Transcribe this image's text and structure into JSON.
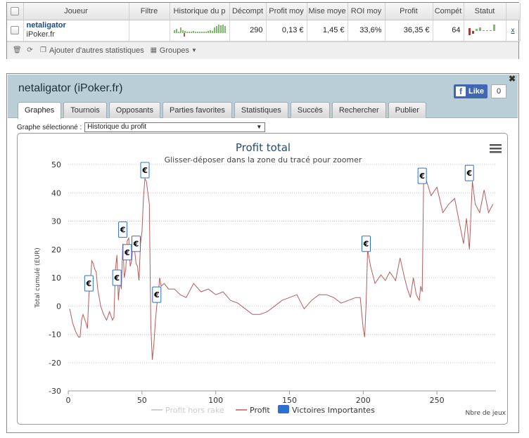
{
  "stats_table": {
    "columns": [
      "Joueur",
      "Filtre",
      "Historique du p",
      "Décompt",
      "Profit moy",
      "Mise moye",
      "ROI moy",
      "Profit",
      "Compét",
      "Statut"
    ],
    "row": {
      "player_name": "netaligator",
      "site": "iPoker.fr",
      "decompte": "290",
      "profit_moy": "0,13 €",
      "mise_moy": "1,45 €",
      "roi_moy": "33,6%",
      "profit": "36,35 €",
      "competitions": "64",
      "close": "x"
    }
  },
  "toolbar": {
    "add_stats": "Ajouter d'autres statistiques",
    "groups": "Groupes"
  },
  "panel": {
    "title": "netaligator (iPoker.fr)",
    "fb_like": "Like",
    "fb_count": "0",
    "tabs": [
      "Graphes",
      "Tournois",
      "Opposants",
      "Parties favorites",
      "Statistiques",
      "Succès",
      "Rechercher",
      "Publier"
    ],
    "graph_select_label": "Graphe sélectionné :",
    "graph_select_value": "Historique du profit"
  },
  "colors": {
    "profit_line": "#b85a5a",
    "rake_line": "#cfcfcf",
    "victory_marker": "#2c6fcf",
    "header_bg": "#b9ced6"
  },
  "chart_data": {
    "type": "line",
    "title": "Profit total",
    "subtitle": "Glisser-déposer dans la zone du tracé pour zoomer",
    "ylabel": "Total cumulé (EUR)",
    "xlabel": "Nbre de jeux",
    "xlim": [
      0,
      290
    ],
    "ylim": [
      -30,
      50
    ],
    "xticks": [
      0,
      50,
      100,
      150,
      200,
      250
    ],
    "yticks": [
      -30,
      -20,
      -10,
      0,
      10,
      20,
      30,
      40,
      50
    ],
    "legend": [
      "Profit hors rake",
      "Profit",
      "Victoires Importantes"
    ],
    "series": [
      {
        "name": "Profit",
        "x": [
          1,
          3,
          5,
          7,
          8,
          9,
          10,
          12,
          13,
          14,
          15,
          16,
          17,
          18,
          19,
          20,
          22,
          24,
          26,
          28,
          30,
          31,
          32,
          33,
          34,
          35,
          36,
          37,
          38,
          39,
          40,
          41,
          42,
          43,
          44,
          45,
          46,
          47,
          48,
          49,
          50,
          51,
          52,
          53,
          54,
          55,
          56,
          57,
          58,
          59,
          60,
          61,
          62,
          63,
          65,
          68,
          72,
          76,
          80,
          85,
          90,
          95,
          100,
          105,
          110,
          115,
          120,
          125,
          130,
          135,
          140,
          145,
          150,
          155,
          160,
          165,
          170,
          175,
          180,
          185,
          190,
          195,
          198,
          200,
          201,
          202,
          203,
          205,
          208,
          212,
          215,
          218,
          222,
          225,
          228,
          230,
          232,
          234,
          236,
          238,
          239,
          240,
          241,
          243,
          246,
          250,
          254,
          258,
          262,
          265,
          268,
          270,
          272,
          274,
          276,
          279,
          282,
          285,
          288
        ],
        "y": [
          -1,
          -6,
          -9,
          -11,
          -11,
          -5,
          -3,
          -6,
          -8,
          4,
          8,
          16,
          15,
          13,
          12,
          6,
          0,
          -3,
          -5,
          -2,
          -5,
          -4,
          13,
          18,
          2,
          9,
          6,
          22,
          10,
          13,
          23,
          24,
          14,
          16,
          22,
          20,
          15,
          14,
          9,
          22,
          26,
          38,
          45,
          44,
          40,
          36,
          -7,
          -19,
          -14,
          -6,
          0,
          4,
          10,
          7,
          8,
          6,
          6,
          4,
          3,
          8,
          5,
          6,
          4,
          5,
          2,
          1,
          -1,
          -3,
          -3,
          -2,
          0,
          2,
          3,
          4,
          -1,
          2,
          4,
          4,
          3,
          1,
          2,
          3,
          3,
          -8,
          -11,
          1,
          20,
          14,
          8,
          11,
          9,
          12,
          9,
          17,
          10,
          6,
          3,
          10,
          4,
          2,
          7,
          5,
          46,
          44,
          39,
          42,
          33,
          36,
          38,
          30,
          22,
          31,
          20,
          44,
          36,
          33,
          41,
          33,
          36
        ]
      }
    ],
    "victories": [
      {
        "x": 14,
        "y": 8
      },
      {
        "x": 33,
        "y": 10
      },
      {
        "x": 37,
        "y": 27
      },
      {
        "x": 40,
        "y": 19
      },
      {
        "x": 46,
        "y": 22
      },
      {
        "x": 52,
        "y": 48
      },
      {
        "x": 60,
        "y": 4
      },
      {
        "x": 202,
        "y": 22
      },
      {
        "x": 240,
        "y": 46
      },
      {
        "x": 272,
        "y": 47
      }
    ],
    "grid": "horizontal-dotted",
    "legend_position": "bottom-center"
  }
}
